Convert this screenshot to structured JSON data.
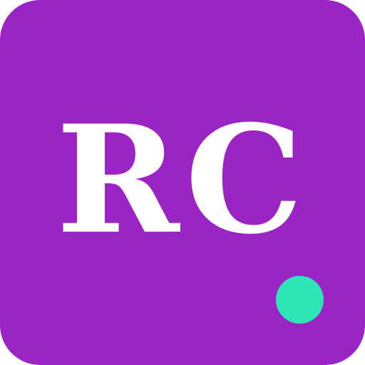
{
  "avatar": {
    "initials": "RC",
    "background_color": "#9b24c4",
    "text_color": "#ffffff"
  },
  "status_indicator": {
    "state": "online",
    "color": "#2ee6b4"
  }
}
